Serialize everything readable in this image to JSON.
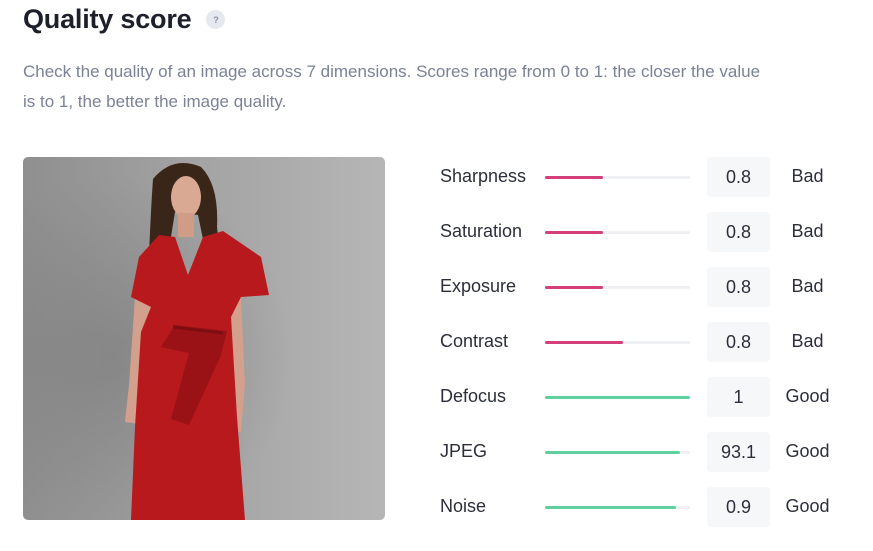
{
  "header": {
    "title": "Quality score",
    "help_icon": "question-mark-icon",
    "help_label": "?"
  },
  "description": "Check the quality of an image across 7 dimensions. Scores range from 0 to 1: the closer the value is to 1, the better the image quality.",
  "colors": {
    "bad": "#d43f7a",
    "good": "#5fd19f"
  },
  "metrics": [
    {
      "name": "Sharpness",
      "value": "0.8",
      "status": "Bad",
      "level": 0.4,
      "tone": "bad"
    },
    {
      "name": "Saturation",
      "value": "0.8",
      "status": "Bad",
      "level": 0.4,
      "tone": "bad"
    },
    {
      "name": "Exposure",
      "value": "0.8",
      "status": "Bad",
      "level": 0.4,
      "tone": "bad"
    },
    {
      "name": "Contrast",
      "value": "0.8",
      "status": "Bad",
      "level": 0.54,
      "tone": "bad"
    },
    {
      "name": "Defocus",
      "value": "1",
      "status": "Good",
      "level": 1.0,
      "tone": "good"
    },
    {
      "name": "JPEG",
      "value": "93.1",
      "status": "Good",
      "level": 0.93,
      "tone": "good"
    },
    {
      "name": "Noise",
      "value": "0.9",
      "status": "Good",
      "level": 0.9,
      "tone": "good"
    }
  ]
}
